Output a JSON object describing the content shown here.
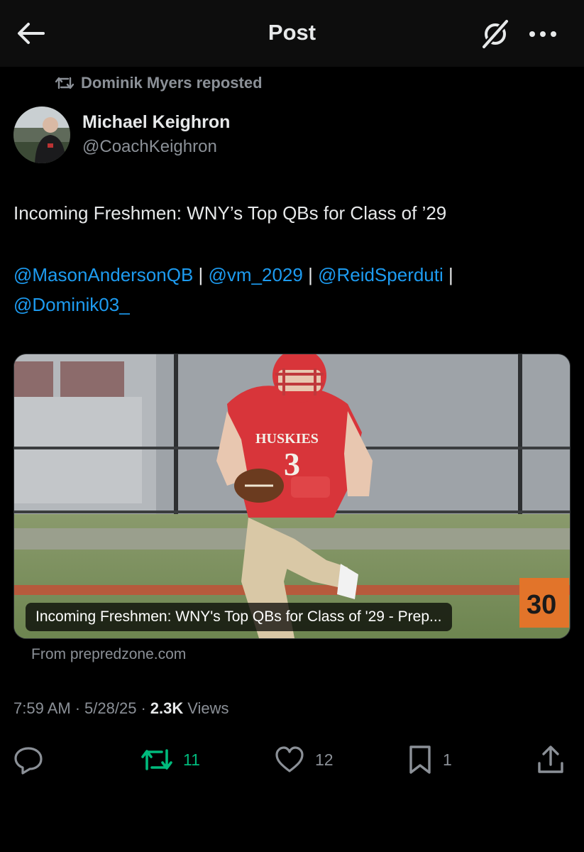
{
  "header": {
    "title": "Post"
  },
  "repost_notice": "Dominik Myers reposted",
  "author": {
    "name": "Michael Keighron",
    "handle": "@CoachKeighron"
  },
  "tweet": {
    "text": "Incoming Freshmen: WNY’s Top QBs for Class of ’29",
    "mentions": [
      "@MasonAndersonQB",
      "@vm_2029",
      "@ReidSperduti",
      "@Dominik03_"
    ],
    "separator": " | "
  },
  "card": {
    "caption": "Incoming Freshmen: WNY's Top QBs for Class of '29 - Prep...",
    "yard_marker": "30",
    "jersey_name": "HUSKIES",
    "jersey_number": "3",
    "source": "From prepredzone.com"
  },
  "meta": {
    "time": "7:59 AM",
    "date": "5/28/25",
    "views_count": "2.3K",
    "views_label": "Views",
    "dot": "·"
  },
  "actions": {
    "replies": "",
    "retweets": "11",
    "likes": "12",
    "bookmarks": "1"
  },
  "colors": {
    "accent": "#1d9bf0",
    "retweet": "#00ba7c",
    "muted": "#8b9097",
    "text": "#e7e9ea",
    "background": "#000000"
  },
  "icons": [
    "back-arrow-icon",
    "grok-icon",
    "more-icon",
    "repost-icon",
    "reply-icon",
    "retweet-icon",
    "like-icon",
    "bookmark-icon",
    "share-icon"
  ]
}
